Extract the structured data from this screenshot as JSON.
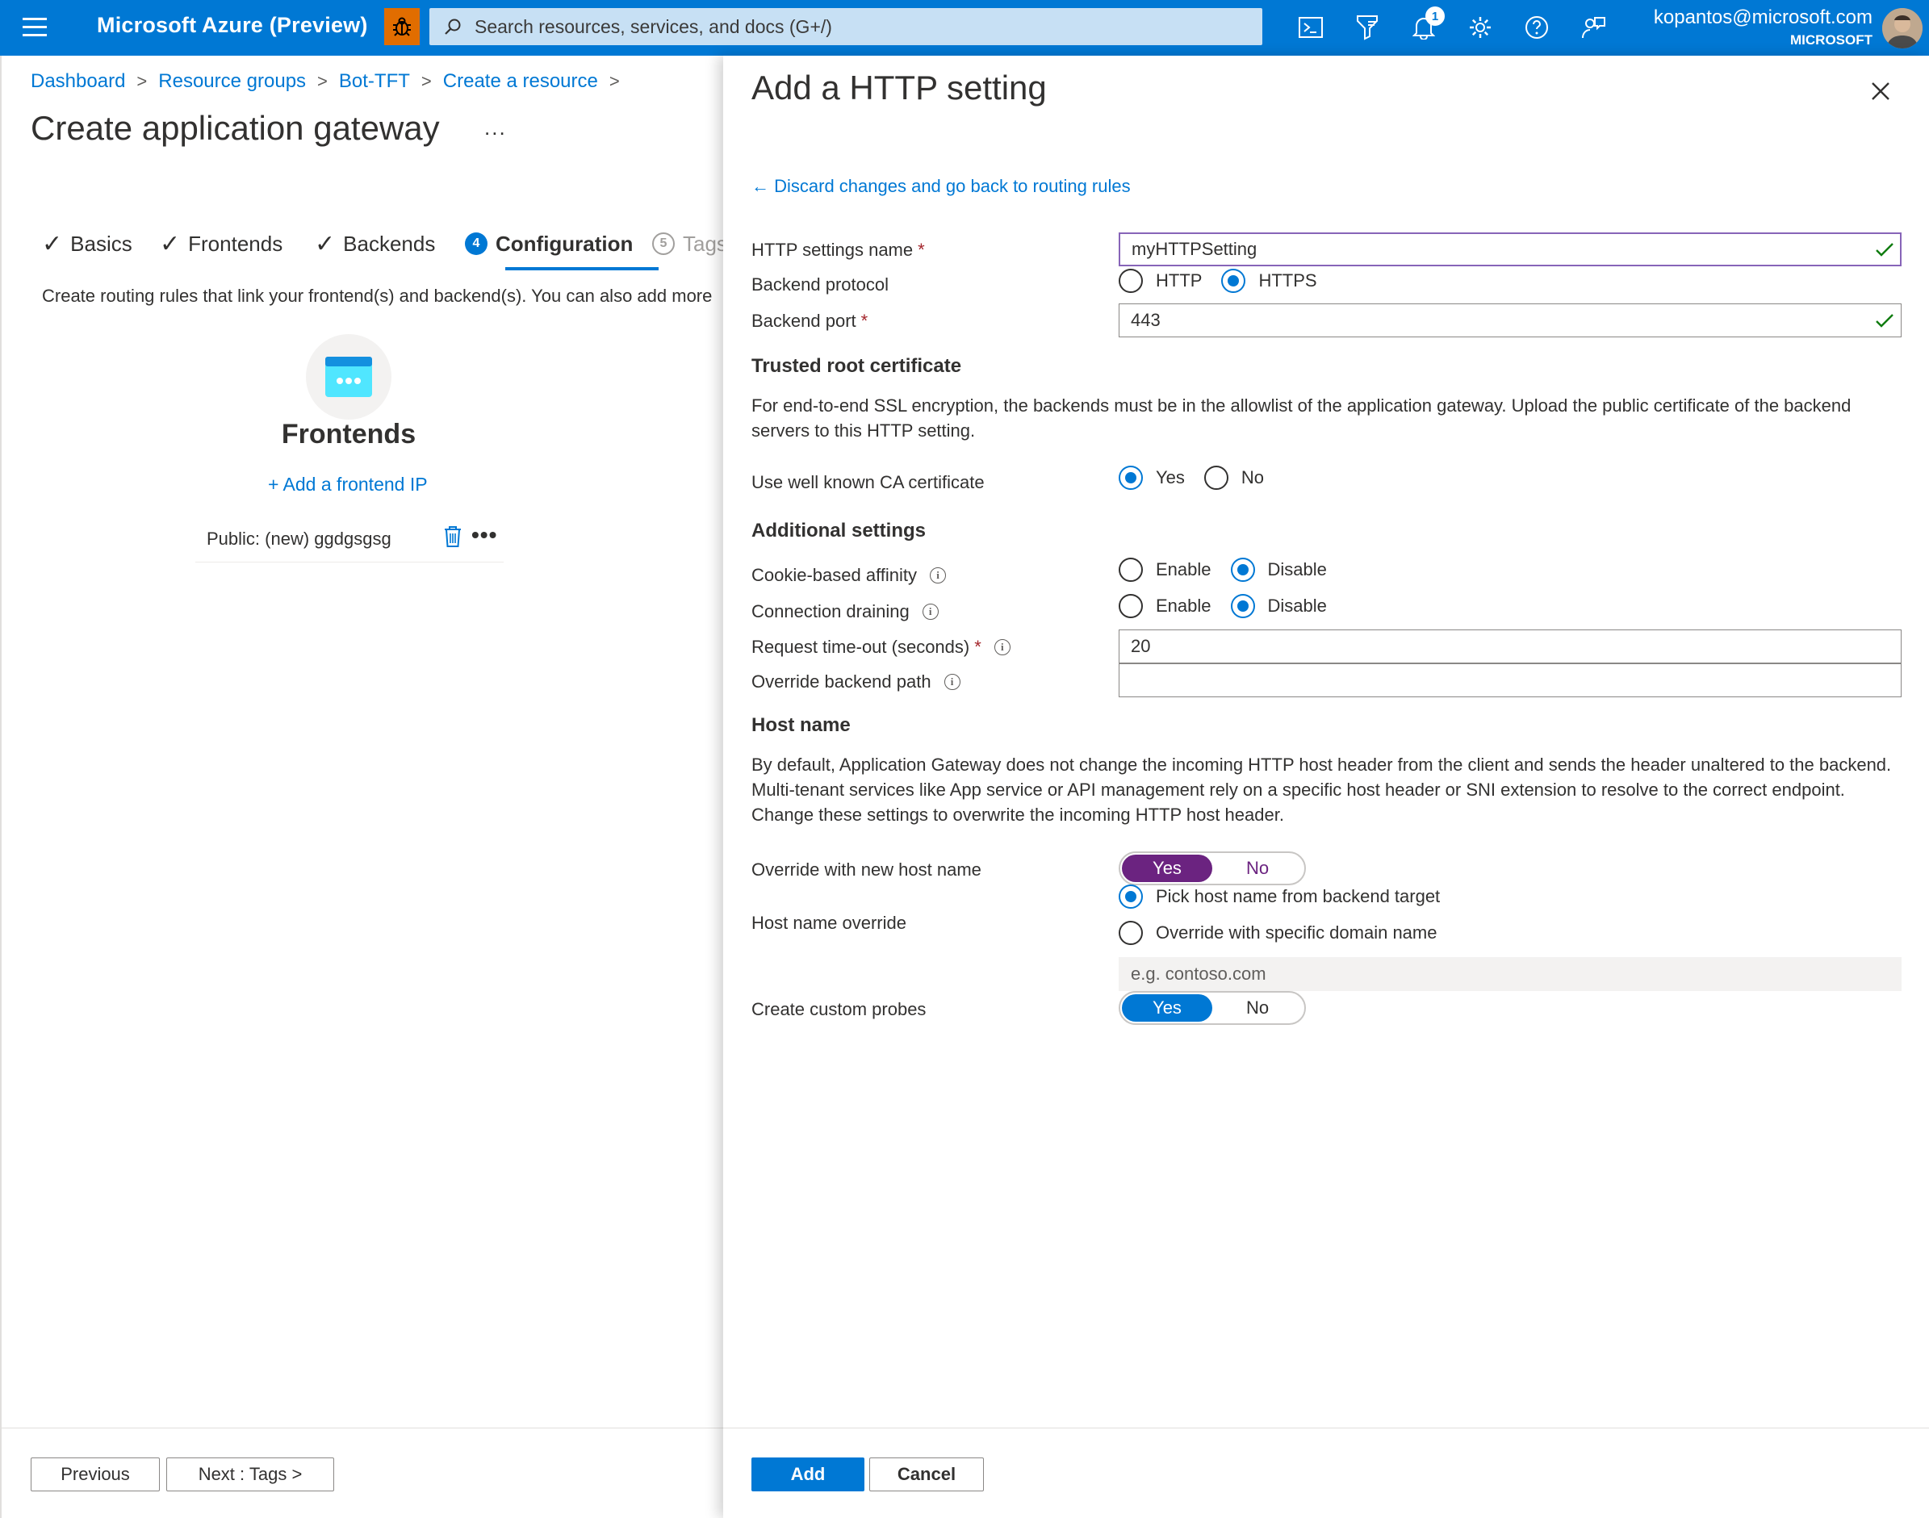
{
  "topbar": {
    "brand": "Microsoft Azure (Preview)",
    "search_placeholder": "Search resources, services, and docs (G+/)",
    "notification_count": "1",
    "account_email": "kopantos@microsoft.com",
    "account_tenant": "MICROSOFT",
    "icons": [
      "menu-icon",
      "bug-icon",
      "search-icon",
      "cloud-shell-icon",
      "directory-filter-icon",
      "bell-icon",
      "gear-icon",
      "help-icon",
      "feedback-icon"
    ]
  },
  "breadcrumb": [
    "Dashboard",
    "Resource groups",
    "Bot-TFT",
    "Create a resource"
  ],
  "page": {
    "title": "Create application gateway",
    "more": "...",
    "tabs": [
      {
        "label": "Basics",
        "state": "done"
      },
      {
        "label": "Frontends",
        "state": "done"
      },
      {
        "label": "Backends",
        "state": "done"
      },
      {
        "label": "Configuration",
        "state": "active",
        "num": "4"
      },
      {
        "label": "Tags",
        "state": "disabled",
        "num": "5"
      }
    ],
    "intro": "Create routing rules that link your frontend(s) and backend(s). You can also add more",
    "frontends_title": "Frontends",
    "add_frontend": "+ Add a frontend IP",
    "frontend_item": "Public: (new) ggdgsgsg",
    "item_more": "•••",
    "footer": {
      "previous": "Previous",
      "next": "Next : Tags >"
    }
  },
  "blade": {
    "title": "Add a HTTP setting",
    "back_link": "← Discard changes and go back to routing rules",
    "http_settings_name": {
      "label": "HTTP settings name",
      "value": "myHTTPSetting"
    },
    "backend_protocol": {
      "label": "Backend protocol",
      "options": [
        "HTTP",
        "HTTPS"
      ],
      "selected": "HTTPS"
    },
    "backend_port": {
      "label": "Backend port",
      "value": "443"
    },
    "required_mark": "*",
    "trusted_root": {
      "heading": "Trusted root certificate",
      "description": "For end-to-end SSL encryption, the backends must be in the allowlist of the application gateway. Upload the public certificate of the backend servers to this HTTP setting."
    },
    "well_known_ca": {
      "label": "Use well known CA certificate",
      "options": [
        "Yes",
        "No"
      ],
      "selected": "Yes"
    },
    "additional": {
      "heading": "Additional settings",
      "cookie_affinity": {
        "label": "Cookie-based affinity",
        "options": [
          "Enable",
          "Disable"
        ],
        "selected": "Disable"
      },
      "connection_draining": {
        "label": "Connection draining",
        "options": [
          "Enable",
          "Disable"
        ],
        "selected": "Disable"
      },
      "request_timeout": {
        "label": "Request time-out (seconds)",
        "value": "20"
      },
      "override_path": {
        "label": "Override backend path",
        "value": ""
      }
    },
    "host_name": {
      "heading": "Host name",
      "description": "By default, Application Gateway does not change the incoming HTTP host header from the client and sends the header unaltered to the backend. Multi-tenant services like App service or API management rely on a specific host header or SNI extension to resolve to the correct endpoint. Change these settings to overwrite the incoming HTTP host header.",
      "override_new": {
        "label": "Override with new host name",
        "options": [
          "Yes",
          "No"
        ],
        "selected": "Yes"
      },
      "override_label": "Host name override",
      "override_options": [
        "Pick host name from backend target",
        "Override with specific domain name"
      ],
      "override_selected": "Pick host name from backend target",
      "domain_placeholder": "e.g. contoso.com"
    },
    "custom_probes": {
      "label": "Create custom probes",
      "options": [
        "Yes",
        "No"
      ],
      "selected": "Yes"
    },
    "footer": {
      "add": "Add",
      "cancel": "Cancel"
    },
    "colors": {
      "accent": "#0078d4",
      "toggle_purple": "#6b2380",
      "required": "#a4262c",
      "valid": "#107c10"
    }
  }
}
